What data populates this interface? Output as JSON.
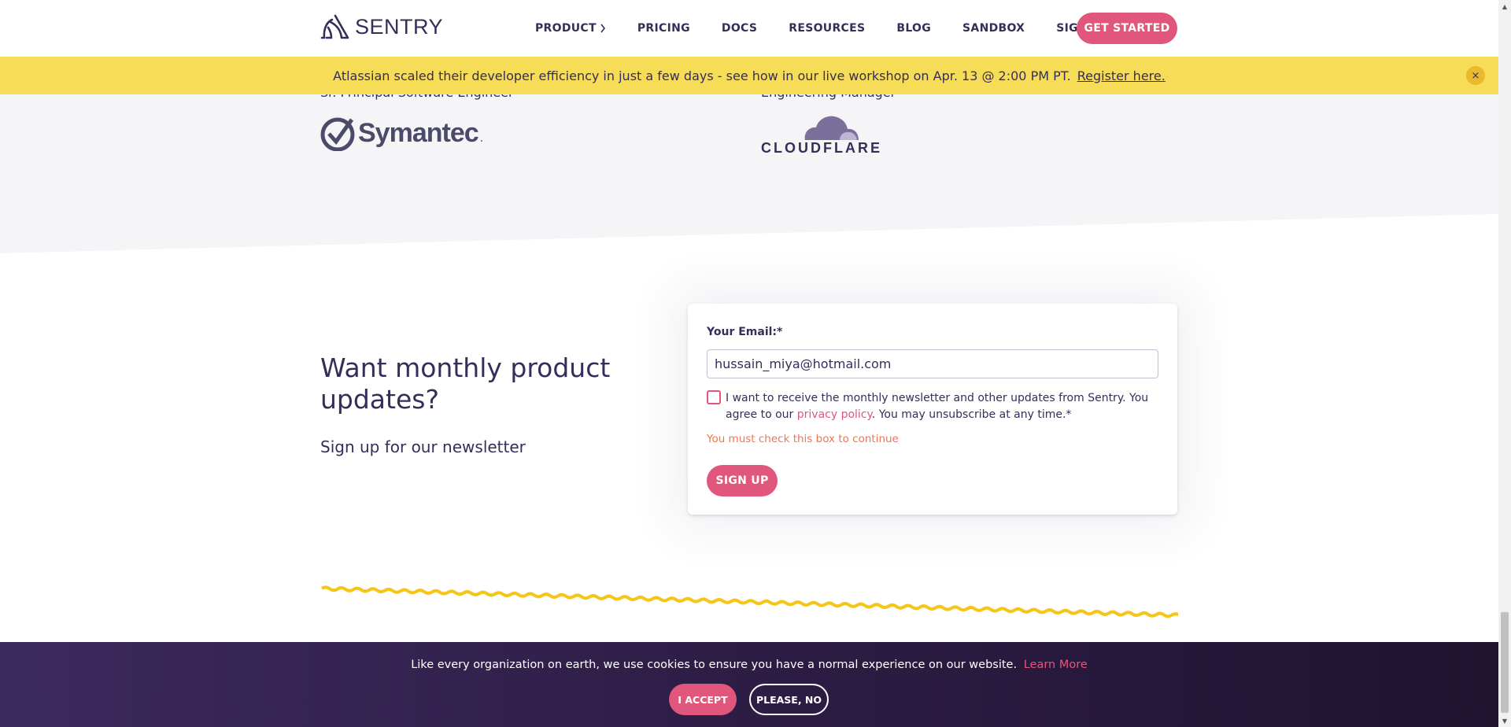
{
  "header": {
    "logo_text": "SENTRY",
    "nav": [
      {
        "label": "PRODUCT"
      },
      {
        "label": "PRICING"
      },
      {
        "label": "DOCS"
      },
      {
        "label": "RESOURCES"
      },
      {
        "label": "BLOG"
      },
      {
        "label": "SANDBOX"
      },
      {
        "label": "SIGN IN"
      }
    ],
    "cta_label": "GET STARTED"
  },
  "announcement": {
    "text": "Atlassian scaled their developer efficiency in just a few days - see how in our live workshop on Apr. 13 @ 2:00 PM PT.",
    "link": "Register here.",
    "close_icon": "×"
  },
  "testimonials": {
    "left_role": "Sr. Principal Software Engineer",
    "left_logo": "Symantec",
    "left_logo_tm": ".",
    "right_role": "Engineering Manager",
    "right_logo": "CLOUDFLARE"
  },
  "newsletter": {
    "heading": "Want monthly product updates?",
    "subheading": "Sign up for our newsletter",
    "email_label": "Your Email:*",
    "email_value": "hussain_miya@hotmail.com",
    "consent_before": "I want to receive the monthly newsletter and other updates from Sentry. You agree to our ",
    "consent_link": "privacy policy",
    "consent_after": ". You may unsubscribe at any time.*",
    "error": "You must check this box to continue",
    "submit_label": "SIGN UP"
  },
  "cookie_banner": {
    "text": "Like every organization on earth, we use cookies to ensure you have a normal experience on our website.",
    "link": "Learn More",
    "accept_label": "I ACCEPT",
    "decline_label": "PLEASE, NO"
  },
  "colors": {
    "brand_pink": "#e1567c",
    "brand_purple": "#362d59",
    "banner_yellow": "#f7dc57",
    "error_orange": "#f2744f"
  }
}
